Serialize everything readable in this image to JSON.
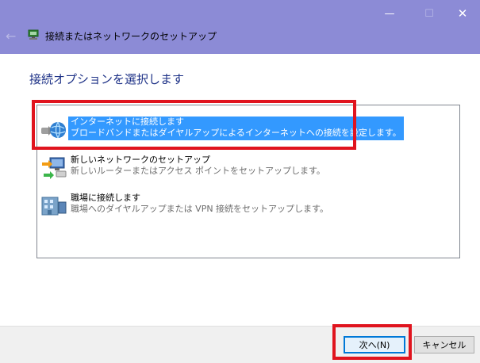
{
  "window": {
    "title": "接続またはネットワークのセットアップ",
    "back_symbol": "←",
    "min_symbol": "—",
    "max_symbol": "☐",
    "close_symbol": "✕"
  },
  "page": {
    "title": "接続オプションを選択します"
  },
  "options": [
    {
      "title": "インターネットに接続します",
      "description": "ブロードバンドまたはダイヤルアップによるインターネットへの接続を設定します。",
      "icon": "globe-network-icon",
      "selected": true
    },
    {
      "title": "新しいネットワークのセットアップ",
      "description": "新しいルーターまたはアクセス ポイントをセットアップします。",
      "icon": "network-setup-icon",
      "selected": false
    },
    {
      "title": "職場に接続します",
      "description": "職場へのダイヤルアップまたは VPN 接続をセットアップします。",
      "icon": "workplace-icon",
      "selected": false
    }
  ],
  "buttons": {
    "next": "次へ(N)",
    "cancel": "キャンセル"
  },
  "colors": {
    "titlebar": "#8c8bd6",
    "selection": "#3399ff",
    "highlight": "#e0141e",
    "heading": "#1e3287"
  }
}
